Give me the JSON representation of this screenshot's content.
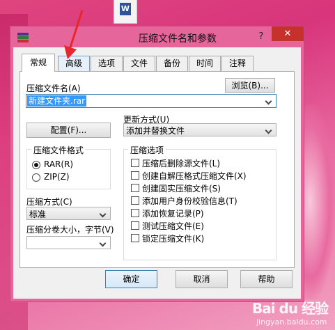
{
  "window": {
    "title": "压缩文件名和参数",
    "help_label": "?",
    "close_label": "✕"
  },
  "tabs": [
    "常规",
    "高级",
    "选项",
    "文件",
    "备份",
    "时间",
    "注释"
  ],
  "general": {
    "archive_name_label": "压缩文件名(A)",
    "browse_label": "浏览(B)...",
    "archive_name_value": "新建文件夹.rar",
    "update_mode_label": "更新方式(U)",
    "update_mode_value": "添加并替换文件",
    "profiles_label": "配置(F)...",
    "format_group_title": "压缩文件格式",
    "format_rar": "RAR(R)",
    "format_zip": "ZIP(Z)",
    "format_selected": "RAR",
    "method_label": "压缩方式(C)",
    "method_value": "标准",
    "volume_label": "压缩分卷大小，字节(V)",
    "volume_value": "",
    "options_group_title": "压缩选项",
    "options": [
      {
        "label": "压缩后删除源文件(L)",
        "checked": false
      },
      {
        "label": "创建自解压格式压缩文件(X)",
        "checked": false
      },
      {
        "label": "创建固实压缩文件(S)",
        "checked": false
      },
      {
        "label": "添加用户身份校验信息(T)",
        "checked": false
      },
      {
        "label": "添加恢复记录(P)",
        "checked": false
      },
      {
        "label": "测试压缩文件(E)",
        "checked": false
      },
      {
        "label": "锁定压缩文件(K)",
        "checked": false
      }
    ]
  },
  "footer": {
    "ok_label": "确定",
    "cancel_label": "取消",
    "help_label": "帮助"
  },
  "watermark": {
    "logo_text": "Bai du 经验",
    "site_text": "jingyan.baidu.com"
  },
  "colors": {
    "desktop_pink": "#e0457f",
    "window_frame": "#e6669b",
    "close_red": "#c7312c",
    "selection_blue": "#3399ff",
    "annotation_red": "#e8262e"
  },
  "icons": [
    "word-document-icon",
    "winrar-icon",
    "help-icon",
    "close-icon",
    "dropdown-chevron-icon",
    "annotation-arrow-icon"
  ]
}
